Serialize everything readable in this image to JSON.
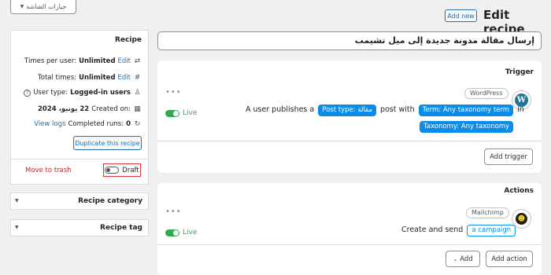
{
  "screen_options": "خيارات الشاشة",
  "header": {
    "title": "Edit recipe",
    "add_new": "Add new"
  },
  "recipe_title": "إرسال مقالة مدونة جديدة إلى ميل تشيمب",
  "sidebar": {
    "recipe_heading": "Recipe",
    "times_per_user_label": "Times per user:",
    "times_per_user_value": "Unlimited",
    "total_times_label": "Total times:",
    "total_times_value": "Unlimited",
    "edit": "Edit",
    "user_type_label": "User type:",
    "user_type_value": "Logged-in users",
    "created_on_label": "Created on:",
    "created_on_value": "22 يونيو، 2024",
    "completed_runs_label": "Completed runs:",
    "completed_runs_value": "0",
    "view_logs": "View logs",
    "duplicate": "Duplicate this recipe",
    "move_to_trash": "Move to trash",
    "draft": "Draft",
    "category": "Recipe category",
    "tag": "Recipe tag"
  },
  "trigger": {
    "heading": "Trigger",
    "integration": "WordPress",
    "status": "Live",
    "text_a": "A user publishes a",
    "post_type": "Post type: مقالة",
    "text_b": "post with",
    "term": "Term: Any taxonomy term",
    "text_c": "in",
    "taxonomy": "Taxonomy: Any taxonomy",
    "add_button": "Add trigger"
  },
  "actions": {
    "heading": "Actions",
    "integration": "Mailchimp",
    "status": "Live",
    "text": "Create and send",
    "campaign": "a campaign",
    "add": "Add",
    "add_action": "Add action"
  },
  "colors": {
    "accent": "#2271b1",
    "live": "#32a852",
    "pill": "#0c8ce9",
    "trash": "#b32d2e"
  }
}
